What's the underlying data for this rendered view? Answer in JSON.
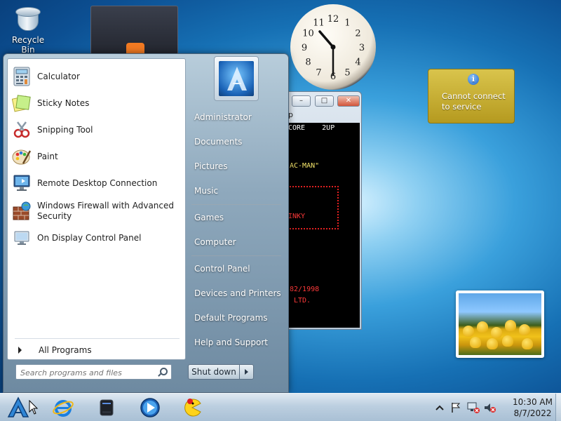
{
  "desktop": {
    "icons": [
      {
        "label": "Recycle Bin",
        "icon": "recycle-bin-icon"
      }
    ]
  },
  "gadgets": {
    "alert": {
      "line1": "Cannot connect",
      "line2": "to service",
      "info_glyph": "i"
    },
    "clock": {
      "time": "10:30",
      "numerals": [
        "12",
        "1",
        "2",
        "3",
        "4",
        "5",
        "6",
        "7",
        "8",
        "9",
        "10",
        "11"
      ]
    }
  },
  "game_window": {
    "title_fragment": "p",
    "lines": {
      "score": "CORE    2UP",
      "name": "AC-MAN\"",
      "ghost": "INKY",
      "copyright": "82/1998",
      "ltd": "LTD."
    }
  },
  "start_menu": {
    "programs": [
      {
        "label": "Calculator",
        "icon": "calculator-icon"
      },
      {
        "label": "Sticky Notes",
        "icon": "sticky-notes-icon"
      },
      {
        "label": "Snipping Tool",
        "icon": "snipping-tool-icon"
      },
      {
        "label": "Paint",
        "icon": "paint-icon"
      },
      {
        "label": "Remote Desktop Connection",
        "icon": "remote-desktop-icon"
      },
      {
        "label_line1": "Windows Firewall with Advanced",
        "label_line2": "Security",
        "icon": "firewall-icon"
      },
      {
        "label": "On Display Control Panel",
        "icon": "display-control-icon"
      }
    ],
    "all_programs": "All Programs",
    "search_placeholder": "Search programs and files",
    "right_items": [
      "Administrator",
      "Documents",
      "Pictures",
      "Music",
      "Games",
      "Computer",
      "Control Panel",
      "Devices and Printers",
      "Default Programs",
      "Help and Support"
    ],
    "shutdown_label": "Shut down"
  },
  "taskbar": {
    "pinned": [
      "start-button",
      "internet-explorer-icon",
      "drive-icon",
      "media-player-icon",
      "ms-pacman-icon"
    ],
    "time": "10:30 AM",
    "date": "8/7/2022",
    "tray_icons": [
      "show-hidden-icons-arrow",
      "action-center-flag-icon",
      "network-icon",
      "volume-muted-icon"
    ]
  }
}
